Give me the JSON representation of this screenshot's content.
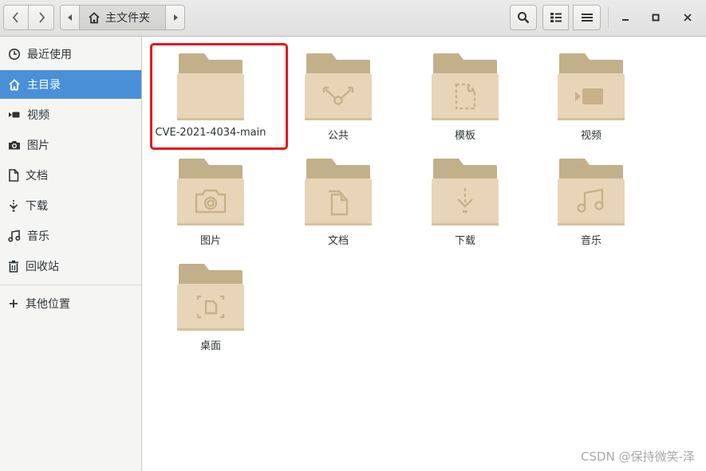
{
  "header": {
    "path_label": "主文件夹"
  },
  "sidebar": {
    "items": [
      {
        "label": "最近使用",
        "icon": "clock-icon"
      },
      {
        "label": "主目录",
        "icon": "home-icon"
      },
      {
        "label": "视频",
        "icon": "video-icon"
      },
      {
        "label": "图片",
        "icon": "camera-icon"
      },
      {
        "label": "文档",
        "icon": "document-icon"
      },
      {
        "label": "下载",
        "icon": "download-icon"
      },
      {
        "label": "音乐",
        "icon": "music-icon"
      },
      {
        "label": "回收站",
        "icon": "trash-icon"
      },
      {
        "label": "其他位置",
        "icon": "plus-icon"
      }
    ],
    "active_index": 1
  },
  "files": [
    {
      "name": "CVE-2021-4034-main",
      "emblem": "none"
    },
    {
      "name": "公共",
      "emblem": "share-icon"
    },
    {
      "name": "模板",
      "emblem": "template-icon"
    },
    {
      "name": "视频",
      "emblem": "video-icon"
    },
    {
      "name": "图片",
      "emblem": "camera-icon"
    },
    {
      "name": "文档",
      "emblem": "document-icon"
    },
    {
      "name": "下载",
      "emblem": "download-icon"
    },
    {
      "name": "音乐",
      "emblem": "music-icon"
    },
    {
      "name": "桌面",
      "emblem": "desktop-icon"
    }
  ],
  "watermark": "CSDN @保持微笑-泽",
  "colors": {
    "accent": "#4a90d9",
    "folder_body": "#e8d5b7",
    "folder_tab": "#c2b08b",
    "highlight": "#e8141a"
  }
}
